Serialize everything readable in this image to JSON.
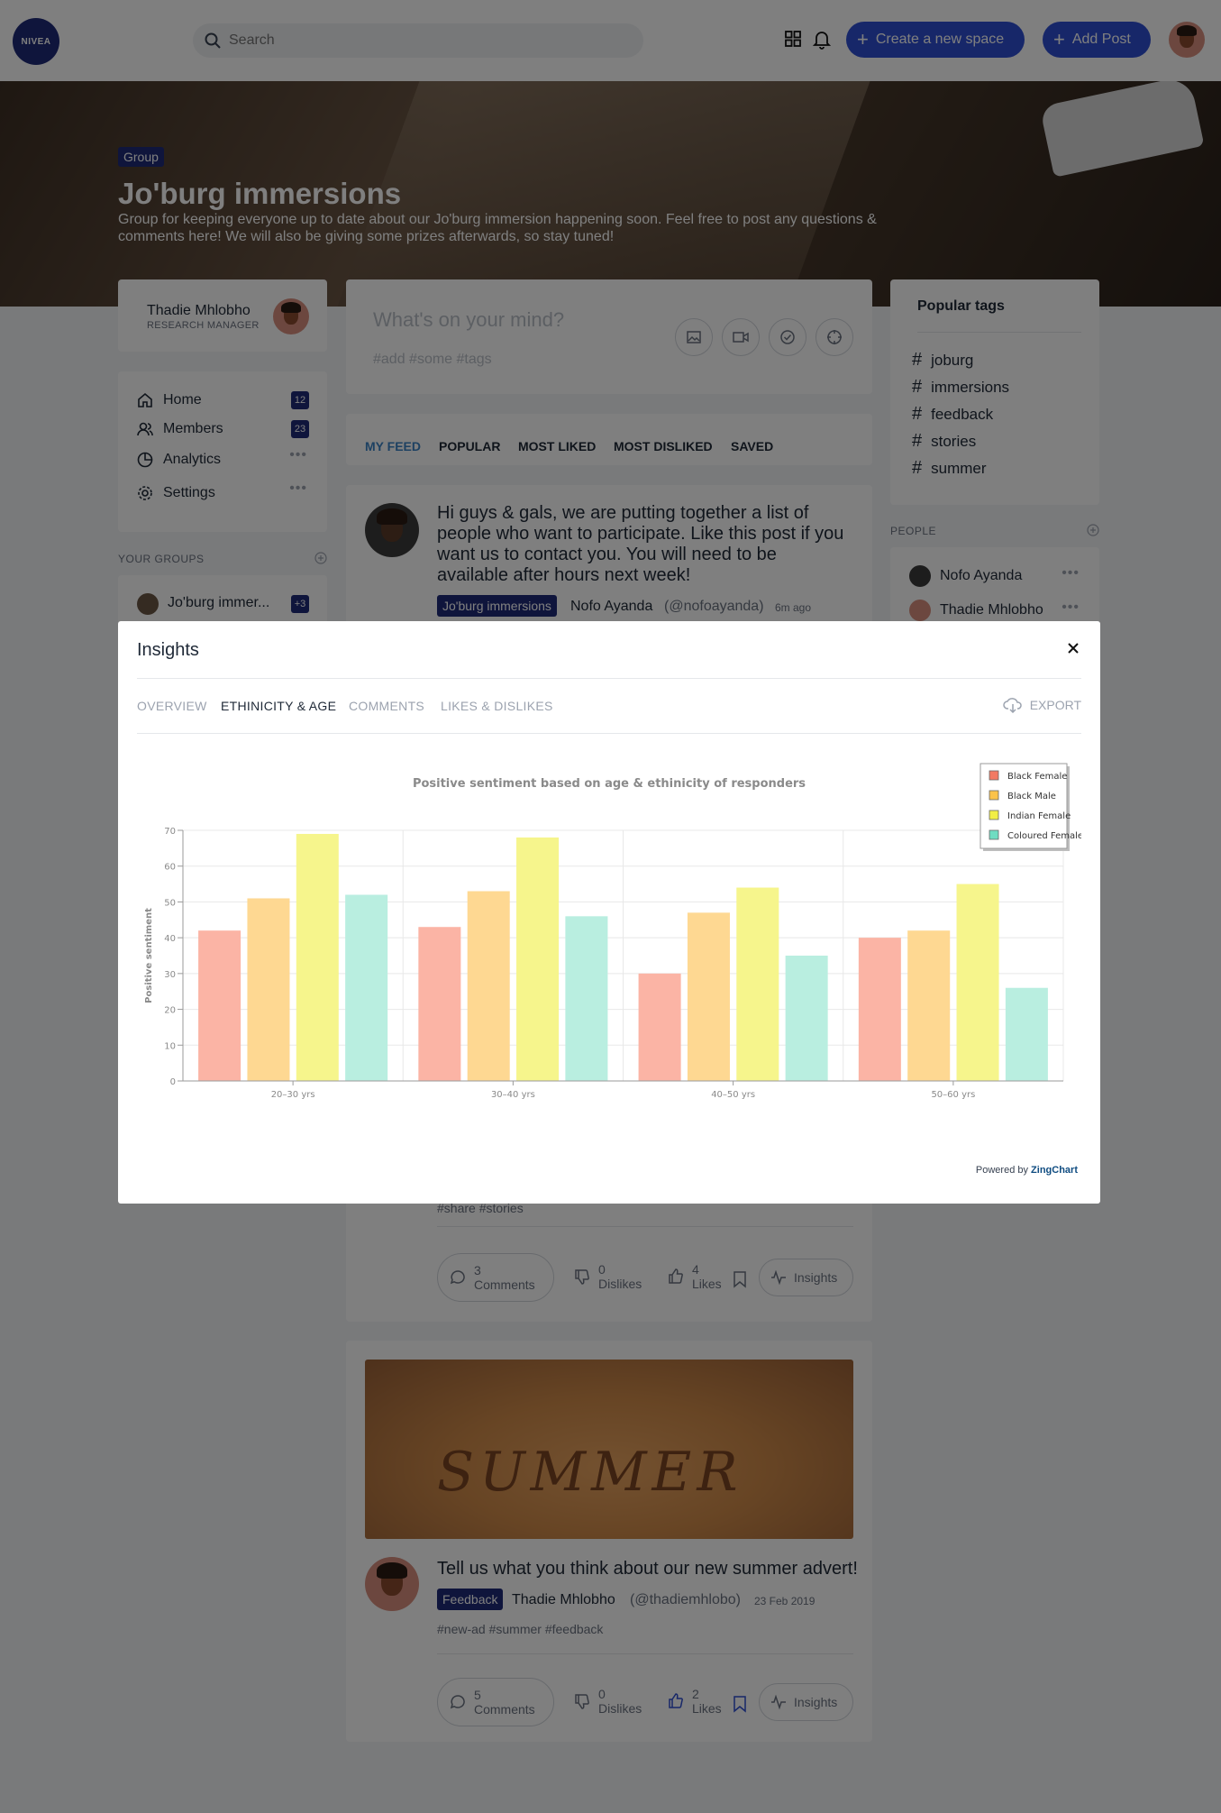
{
  "header": {
    "logo_text": "NIVEA",
    "search_placeholder": "Search",
    "create_space_label": "Create a new space",
    "add_post_label": "Add Post"
  },
  "banner": {
    "badge": "Group",
    "title": "Jo'burg immersions",
    "description": "Group for keeping everyone up to date about our Jo'burg immersion happening soon. Feel free to post any questions & comments here! We will also be giving some prizes afterwards, so stay tuned!"
  },
  "profile": {
    "name": "Thadie Mhlobho",
    "role": "RESEARCH MANAGER"
  },
  "nav": {
    "items": [
      {
        "label": "Home",
        "badge": "12",
        "icon": "home-icon"
      },
      {
        "label": "Members",
        "badge": "23",
        "icon": "users-icon"
      },
      {
        "label": "Analytics",
        "icon": "analytics-icon"
      },
      {
        "label": "Settings",
        "icon": "gear-icon"
      }
    ]
  },
  "groups": {
    "label": "YOUR GROUPS",
    "item": "Jo'burg immer...",
    "badge": "+3"
  },
  "composer": {
    "placeholder": "What's on your mind?",
    "tags_placeholder": "#add #some #tags"
  },
  "feed_tabs": [
    "MY FEED",
    "POPULAR",
    "MOST LIKED",
    "MOST DISLIKED",
    "SAVED"
  ],
  "post1": {
    "text": "Hi guys & gals, we are putting together a list of people who want to participate. Like this post if you want us to contact you. You will need to be available after hours next week!",
    "chip": "Jo'burg immersions",
    "author": "Nofo Ayanda",
    "handle": "(@nofoayanda)",
    "time": "6m ago",
    "hashtags": "#share  #stories",
    "comments": {
      "count": "3",
      "label": "Comments"
    },
    "dislikes": {
      "count": "0",
      "label": "Dislikes"
    },
    "likes": {
      "count": "4",
      "label": "Likes"
    },
    "insights_label": "Insights"
  },
  "post2": {
    "image_text": "SUMMER",
    "text": "Tell us what you think about our new summer advert!",
    "chip": "Feedback",
    "author": "Thadie Mhlobho",
    "handle": "(@thadiemhlobo)",
    "time": "23 Feb 2019",
    "hashtags": "#new-ad  #summer  #feedback",
    "comments": {
      "count": "5",
      "label": "Comments"
    },
    "dislikes": {
      "count": "0",
      "label": "Dislikes"
    },
    "likes": {
      "count": "2",
      "label": "Likes"
    },
    "insights_label": "Insights"
  },
  "popular_tags": {
    "title": "Popular tags",
    "tags": [
      "joburg",
      "immersions",
      "feedback",
      "stories",
      "summer"
    ]
  },
  "people": {
    "label": "PEOPLE",
    "items": [
      "Nofo Ayanda",
      "Thadie Mhlobho"
    ]
  },
  "modal": {
    "title": "Insights",
    "tabs": [
      "OVERVIEW",
      "ETHINICITY & AGE",
      "COMMENTS",
      "LIKES & DISLIKES"
    ],
    "active_tab": 1,
    "export_label": "EXPORT",
    "powered_prefix": "Powered by",
    "powered_brand": "ZingChart"
  },
  "colors": {
    "brand_navy": "#1e2a78",
    "primary_blue": "#2f4fd3",
    "active_tab": "#3b82c4"
  },
  "chart_data": {
    "type": "bar",
    "title": "Positive sentiment based on age & ethinicity of responders",
    "ylabel": "Positive sentiment",
    "xlabel": "",
    "categories": [
      "20–30 yrs",
      "30–40 yrs",
      "40–50 yrs",
      "50–60 yrs"
    ],
    "ylim": [
      0,
      70
    ],
    "yticks": [
      0,
      10,
      20,
      30,
      40,
      50,
      60,
      70
    ],
    "legend_position": "top-right",
    "series": [
      {
        "name": "Black Female",
        "values": [
          42,
          43,
          30,
          40
        ],
        "color": "#fbb4a5",
        "swatch": "#f27a63"
      },
      {
        "name": "Black Male",
        "values": [
          51,
          53,
          47,
          42
        ],
        "color": "#fed892",
        "swatch": "#fbc34a"
      },
      {
        "name": "Indian Female",
        "values": [
          69,
          68,
          54,
          55
        ],
        "color": "#f6f58c",
        "swatch": "#f2ee46"
      },
      {
        "name": "Coloured Female",
        "values": [
          52,
          46,
          35,
          26
        ],
        "color": "#b9eee0",
        "swatch": "#6fddc2"
      }
    ]
  }
}
